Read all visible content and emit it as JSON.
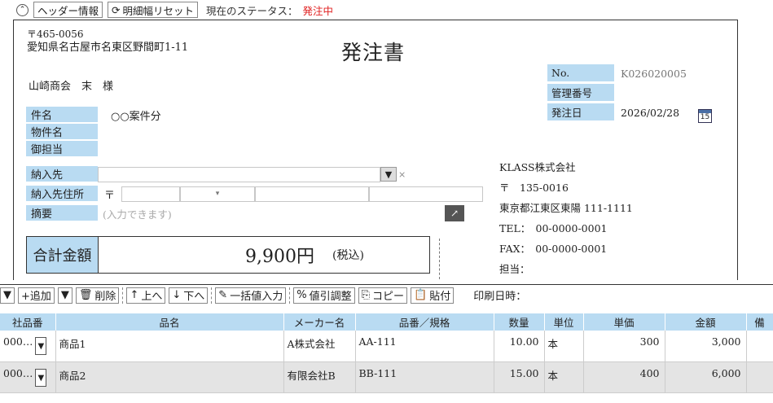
{
  "top": {
    "header_info_label": "ヘッダー情報",
    "reset_label": "明細幅リセット",
    "status_label": "現在のステータス：",
    "status_value": "発注中"
  },
  "doc": {
    "postal": "〒465-0056",
    "address": "愛知県名古屋市名東区野間町1-11",
    "title": "発注書",
    "customer": "山崎商会　末　様",
    "fields": {
      "kenmei_label": "件名",
      "kenmei_value": "○○案件分",
      "bukken_label": "物件名",
      "tantou_label": "御担当",
      "nounyu_label": "納入先",
      "nounyu_addr_label": "納入先住所",
      "postal_mark": "〒",
      "tekiyou_label": "摘要",
      "tekiyou_placeholder": "(入力できます)"
    },
    "right": {
      "no_label": "No.",
      "no_value": "K026020005",
      "kanri_label": "管理番号",
      "date_label": "発注日",
      "date_value": "2026/02/28",
      "cal_day": "15"
    },
    "company": {
      "name": "KLASS株式会社",
      "postal": "〒　135-0016",
      "address": "東京都江東区東陽 111-1111",
      "tel": "TEL：　00-0000-0001",
      "fax": "FAX：　00-0000-0001",
      "tantou": "担当："
    },
    "total": {
      "label": "合計金額",
      "value": "9,900円",
      "tax": "(税込)"
    }
  },
  "detail_bar": {
    "add": "+追加",
    "delete": "削除",
    "up": "上へ",
    "down": "下へ",
    "bulk": "一括値入力",
    "discount": "値引調整",
    "copy": "コピー",
    "paste": "貼付",
    "print_date": "印刷日時："
  },
  "table": {
    "headers": [
      "社品番",
      "品名",
      "メーカー名",
      "品番／規格",
      "数量",
      "単位",
      "単価",
      "金額",
      "備"
    ],
    "rows": [
      {
        "code": "000…",
        "name": "商品1",
        "maker": "A株式会社",
        "part": "AA-111",
        "qty": "10.00",
        "unit": "本",
        "price": "300",
        "amount": "3,000"
      },
      {
        "code": "000…",
        "name": "商品2",
        "maker": "有限会社B",
        "part": "BB-111",
        "qty": "15.00",
        "unit": "本",
        "price": "400",
        "amount": "6,000"
      }
    ]
  }
}
